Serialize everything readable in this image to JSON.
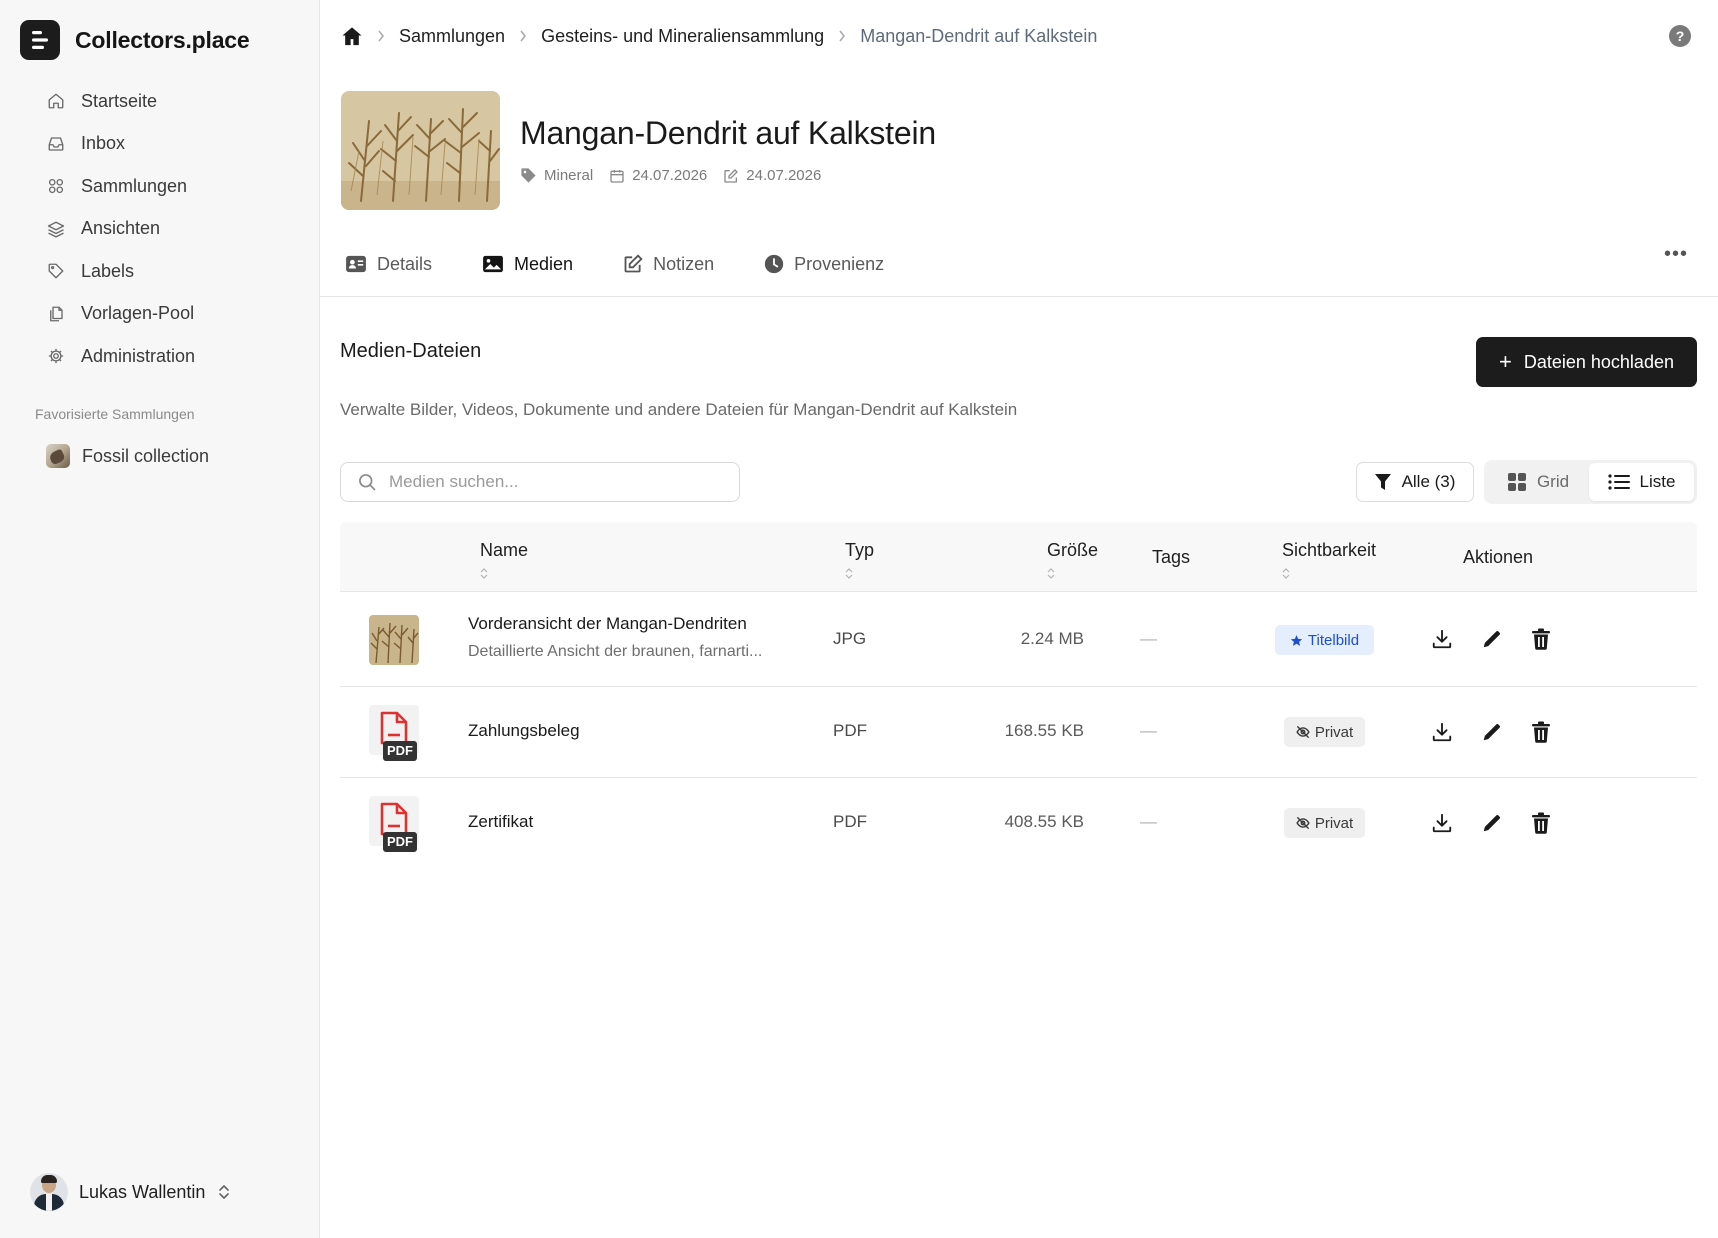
{
  "app": {
    "name": "Collectors.place"
  },
  "sidebar": {
    "items": [
      {
        "label": "Startseite",
        "icon": "home-icon"
      },
      {
        "label": "Inbox",
        "icon": "inbox-icon"
      },
      {
        "label": "Sammlungen",
        "icon": "grid-icon"
      },
      {
        "label": "Ansichten",
        "icon": "layers-icon"
      },
      {
        "label": "Labels",
        "icon": "tag-icon"
      },
      {
        "label": "Vorlagen-Pool",
        "icon": "copy-icon"
      },
      {
        "label": "Administration",
        "icon": "gear-icon"
      }
    ],
    "favorites_title": "Favorisierte Sammlungen",
    "favorites": [
      {
        "label": "Fossil collection"
      }
    ],
    "user": {
      "name": "Lukas Wallentin"
    }
  },
  "breadcrumb": [
    {
      "label": "Sammlungen"
    },
    {
      "label": "Gesteins- und Mineraliensammlung"
    },
    {
      "label": "Mangan-Dendrit auf Kalkstein"
    }
  ],
  "item": {
    "title": "Mangan-Dendrit auf Kalkstein",
    "category": "Mineral",
    "created": "24.07.2026",
    "modified": "24.07.2026"
  },
  "tabs": [
    {
      "label": "Details"
    },
    {
      "label": "Medien"
    },
    {
      "label": "Notizen"
    },
    {
      "label": "Provenienz"
    }
  ],
  "media": {
    "title": "Medien-Dateien",
    "description": "Verwalte Bilder, Videos, Dokumente und andere Dateien für Mangan-Dendrit auf Kalkstein",
    "upload_label": "Dateien hochladen",
    "search_placeholder": "Medien suchen...",
    "filter_label": "Alle (3)",
    "view_grid": "Grid",
    "view_list": "Liste",
    "columns": {
      "name": "Name",
      "type": "Typ",
      "size": "Größe",
      "tags": "Tags",
      "visibility": "Sichtbarkeit",
      "actions": "Aktionen"
    },
    "rows": [
      {
        "name": "Vorderansicht der Mangan-Dendriten",
        "description": "Detaillierte Ansicht der braunen, farnarti...",
        "type": "JPG",
        "size": "2.24 MB",
        "tags": "—",
        "visibility": "Titelbild"
      },
      {
        "name": "Zahlungsbeleg",
        "description": "",
        "type": "PDF",
        "size": "168.55 KB",
        "tags": "—",
        "visibility": "Privat"
      },
      {
        "name": "Zertifikat",
        "description": "",
        "type": "PDF",
        "size": "408.55 KB",
        "tags": "—",
        "visibility": "Privat"
      }
    ],
    "pdf_badge": "PDF"
  },
  "colors": {
    "accent_dark": "#1c1c1c",
    "badge_blue_bg": "#e4eefd",
    "badge_blue_text": "#1d4fd0",
    "pdf_red": "#e03131",
    "sidebar_bg": "#f7f7f7"
  }
}
